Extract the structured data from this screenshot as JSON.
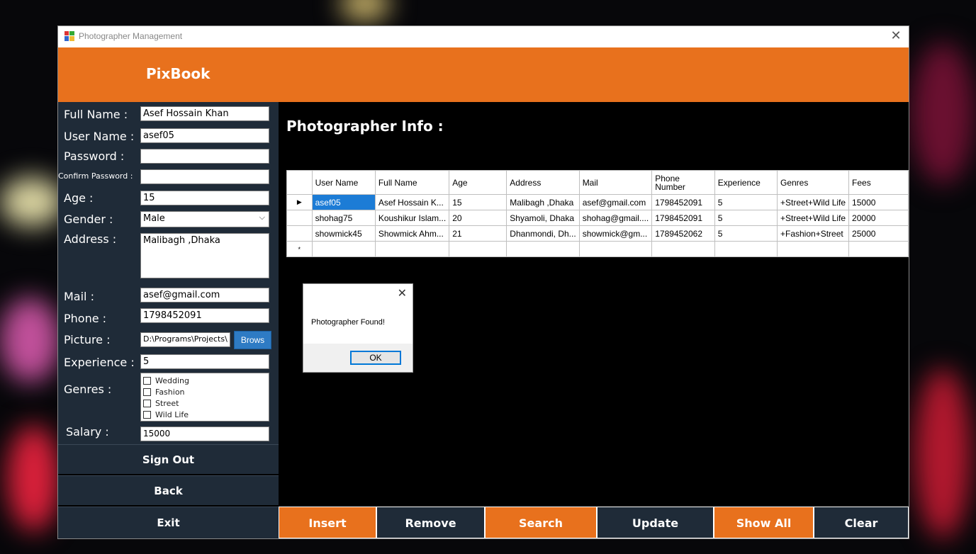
{
  "window": {
    "title": "Photographer Management",
    "close_glyph": "✕"
  },
  "header": {
    "brand": "PixBook"
  },
  "form": {
    "full_name_label": "Full Name :",
    "full_name_value": "Asef Hossain Khan",
    "user_name_label": "User Name :",
    "user_name_value": "asef05",
    "password_label": "Password :",
    "password_value": "",
    "confirm_password_label": "Confirm Password :",
    "confirm_password_value": "",
    "age_label": "Age :",
    "age_value": "15",
    "gender_label": "Gender :",
    "gender_value": "Male",
    "address_label": "Address :",
    "address_value": "Malibagh ,Dhaka",
    "mail_label": "Mail :",
    "mail_value": "asef@gmail.com",
    "phone_label": "Phone :",
    "phone_value": "1798452091",
    "picture_label": "Picture :",
    "picture_value": "D:\\Programs\\Projects\\",
    "browse_label": "Brows",
    "experience_label": "Experience :",
    "experience_value": "5",
    "genres_label": "Genres :",
    "genres": [
      "Wedding",
      "Fashion",
      "Street",
      "Wild Life"
    ],
    "salary_label": "Salary :",
    "salary_value": "15000"
  },
  "nav": {
    "sign_out": "Sign Out",
    "back": "Back",
    "exit": "Exit"
  },
  "content": {
    "title": "Photographer Info :"
  },
  "grid": {
    "columns": [
      "User Name",
      "Full Name",
      "Age",
      "Address",
      "Mail",
      "Phone Number",
      "Experience",
      "Genres",
      "Fees"
    ],
    "rows": [
      [
        "asef05",
        "Asef Hossain K...",
        "15",
        "Malibagh ,Dhaka",
        "asef@gmail.com",
        "1798452091",
        "5",
        "+Street+Wild Life",
        "15000"
      ],
      [
        "shohag75",
        "Koushikur Islam...",
        "20",
        "Shyamoli, Dhaka",
        "shohag@gmail....",
        "1798452091",
        "5",
        "+Street+Wild Life",
        "20000"
      ],
      [
        "showmick45",
        "Showmick Ahm...",
        "21",
        "Dhanmondi, Dh...",
        "showmick@gm...",
        "1789452062",
        "5",
        "+Fashion+Street",
        "25000"
      ]
    ],
    "current_row_marker": "▶",
    "new_row_marker": "*"
  },
  "actions": {
    "insert": "Insert",
    "remove": "Remove",
    "search": "Search",
    "update": "Update",
    "show_all": "Show All",
    "clear": "Clear"
  },
  "dialog": {
    "message": "Photographer Found!",
    "ok": "OK",
    "close_glyph": "✕"
  },
  "colors": {
    "accent": "#E8711D",
    "panel": "#1f2b38",
    "selection": "#1c7cd6"
  },
  "icons": {
    "app": "app-icon",
    "dropdown": "chevron-down-icon",
    "row_pointer": "row-pointer-icon"
  }
}
